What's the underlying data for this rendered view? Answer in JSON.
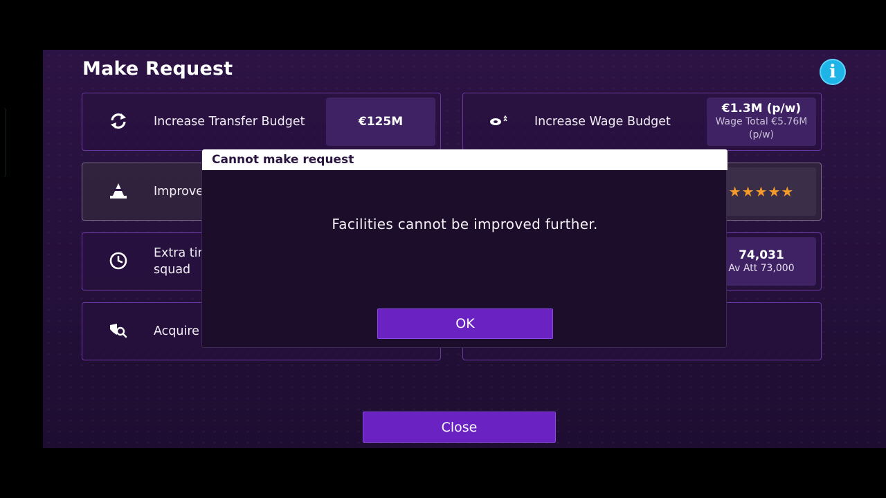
{
  "header": {
    "title": "Make Request"
  },
  "requests": [
    {
      "label": "Increase Transfer Budget",
      "value": "€125M",
      "icon": "refresh-icon"
    },
    {
      "label": "Increase Wage Budget",
      "value": "€1.3M (p/w)",
      "sub1": "Wage Total €5.76M",
      "sub2": "(p/w)",
      "icon": "money-icon"
    },
    {
      "label": "Improve",
      "stars": "★★★★★",
      "icon": "cone-icon"
    },
    {
      "label_line1": "Extra tin",
      "label_line2": "squad",
      "value": "74,031",
      "sub1": "Av Att 73,000",
      "icon": "clock-icon"
    },
    {
      "label": "Acquire",
      "icon": "scout-icon"
    }
  ],
  "dialog": {
    "title": "Cannot make request",
    "message": "Facilities cannot be improved further.",
    "ok_label": "OK"
  },
  "footer": {
    "close_label": "Close"
  },
  "colors": {
    "accent": "#6a22c2",
    "info": "#1fb4e8",
    "stars": "#f39a2a"
  }
}
